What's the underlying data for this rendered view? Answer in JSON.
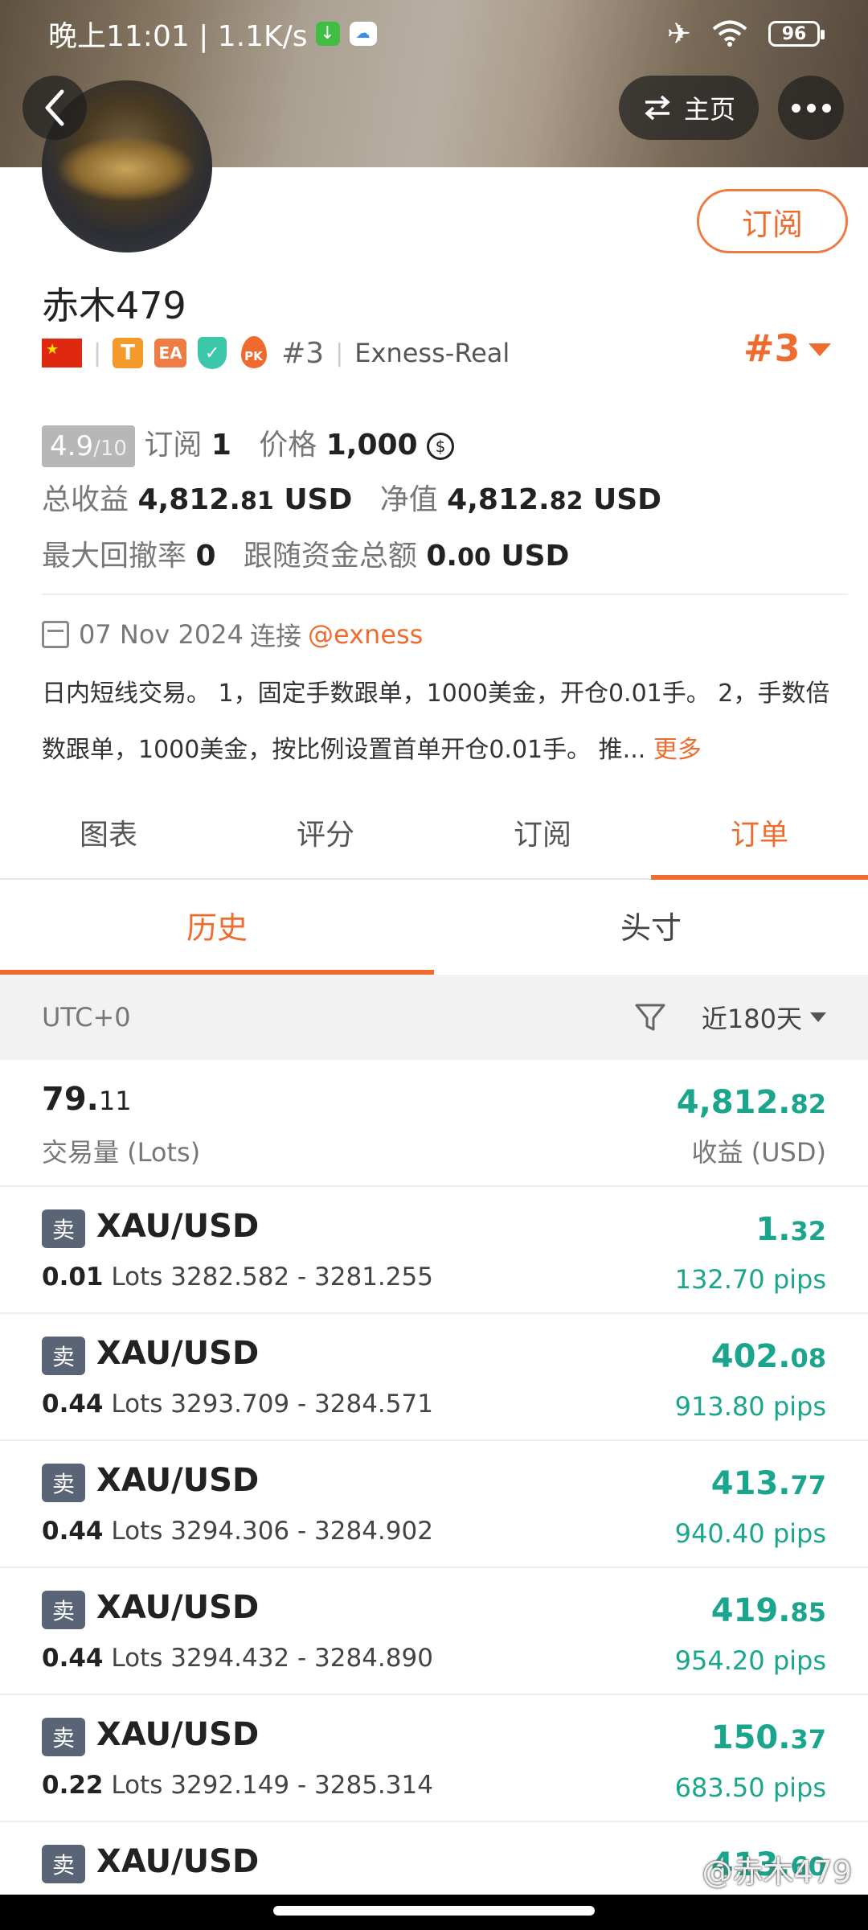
{
  "status_bar": {
    "time": "晚上11:01 | 1.1K/s",
    "battery": "96"
  },
  "nav": {
    "home_label": "主页"
  },
  "profile": {
    "subscribe_label": "订阅",
    "name": "赤木479",
    "rank_small": "#3",
    "broker": "Exness-Real",
    "rank_big": "#3",
    "tags": [
      "T",
      "EA",
      "PK"
    ]
  },
  "stats": {
    "score": "4.9",
    "score_den": "/10",
    "subs_label": "订阅",
    "subs_value": "1",
    "price_label": "价格",
    "price_value": "1,000",
    "total_profit_label": "总收益",
    "total_profit_int": "4,812.",
    "total_profit_dec": "81",
    "total_profit_unit": "USD",
    "equity_label": "净值",
    "equity_int": "4,812.",
    "equity_dec": "82",
    "equity_unit": "USD",
    "drawdown_label": "最大回撤率",
    "drawdown_value": "0",
    "follow_label": "跟随资金总额",
    "follow_int": "0.",
    "follow_dec": "00",
    "follow_unit": "USD"
  },
  "join": {
    "date": "07 Nov 2024",
    "connect_label": "连接",
    "broker_link": "@exness"
  },
  "description": {
    "text": "日内短线交易。 1，固定手数跟单，1000美金，开仓0.01手。 2，手数倍数跟单，1000美金，按比例设置首单开仓0.01手。 推...",
    "more": "更多"
  },
  "tabs": [
    "图表",
    "评分",
    "订阅",
    "订单"
  ],
  "subtabs": [
    "历史",
    "头寸"
  ],
  "filter": {
    "timezone": "UTC+0",
    "range": "近180天"
  },
  "summary": {
    "lots_int": "79.",
    "lots_dec": "11",
    "lots_label": "交易量 (Lots)",
    "profit_int": "4,812.",
    "profit_dec": "82",
    "profit_label": "收益 (USD)"
  },
  "orders": [
    {
      "side": "卖",
      "pair": "XAU/USD",
      "lots": "0.01",
      "lots_unit": "Lots",
      "range": "3282.582 - 3281.255",
      "pnl_int": "1.",
      "pnl_dec": "32",
      "pips": "132.70 pips"
    },
    {
      "side": "卖",
      "pair": "XAU/USD",
      "lots": "0.44",
      "lots_unit": "Lots",
      "range": "3293.709 - 3284.571",
      "pnl_int": "402.",
      "pnl_dec": "08",
      "pips": "913.80 pips"
    },
    {
      "side": "卖",
      "pair": "XAU/USD",
      "lots": "0.44",
      "lots_unit": "Lots",
      "range": "3294.306 - 3284.902",
      "pnl_int": "413.",
      "pnl_dec": "77",
      "pips": "940.40 pips"
    },
    {
      "side": "卖",
      "pair": "XAU/USD",
      "lots": "0.44",
      "lots_unit": "Lots",
      "range": "3294.432 - 3284.890",
      "pnl_int": "419.",
      "pnl_dec": "85",
      "pips": "954.20 pips"
    },
    {
      "side": "卖",
      "pair": "XAU/USD",
      "lots": "0.22",
      "lots_unit": "Lots",
      "range": "3292.149 - 3285.314",
      "pnl_int": "150.",
      "pnl_dec": "37",
      "pips": "683.50 pips"
    },
    {
      "side": "卖",
      "pair": "XAU/USD",
      "lots": "",
      "lots_unit": "",
      "range": "",
      "pnl_int": "413.",
      "pnl_dec": "60",
      "pips": ""
    }
  ],
  "watermark": "@赤木479",
  "colors": {
    "accent": "#ee6c2f",
    "profit": "#1aa58c"
  }
}
